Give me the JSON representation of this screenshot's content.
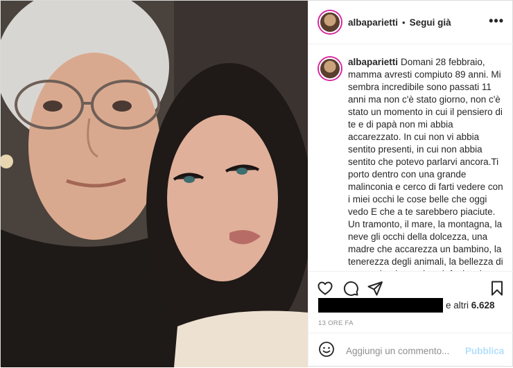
{
  "post": {
    "author": "albaparietti",
    "follow_label": "Segui già",
    "caption_author": "albaparietti",
    "caption": "Domani 28 febbraio, mamma avresti compiuto 89 anni. Mi sembra incredibile sono passati 11 anni ma non c'è stato giorno, non c'è stato un momento in cui il pensiero di te e di papà non mi abbia accarezzato. In cui non vi abbia sentito presenti, in cui non abbia sentito che potevo parlarvi ancora.Ti porto dentro con una grande malinconia e cerco di farti vedere con i miei occhi le cose belle che oggi vedo E che a te sarebbero piaciute. Un tramonto, il mare, la montagna, la neve gli occhi della dolcezza, una madre che accarezza un bambino, la tenerezza degli animali, la bellezza di un quadro, la musica sinfonica, le canzoni che ti",
    "likes_prefix": "e altri",
    "likes_count": "6.628",
    "timestamp": "13 ORE FA",
    "comment_placeholder": "Aggiungi un commento...",
    "publish_label": "Pubblica"
  },
  "colors": {
    "publish_disabled": "#b2dffc",
    "muted_text": "#8e8e8e",
    "story_ring": "#d6249f"
  },
  "icons": {
    "more": "more-options-icon",
    "like": "heart-icon",
    "comment": "comment-bubble-icon",
    "share": "paper-plane-icon",
    "save": "bookmark-icon",
    "emoji": "smiley-icon"
  }
}
